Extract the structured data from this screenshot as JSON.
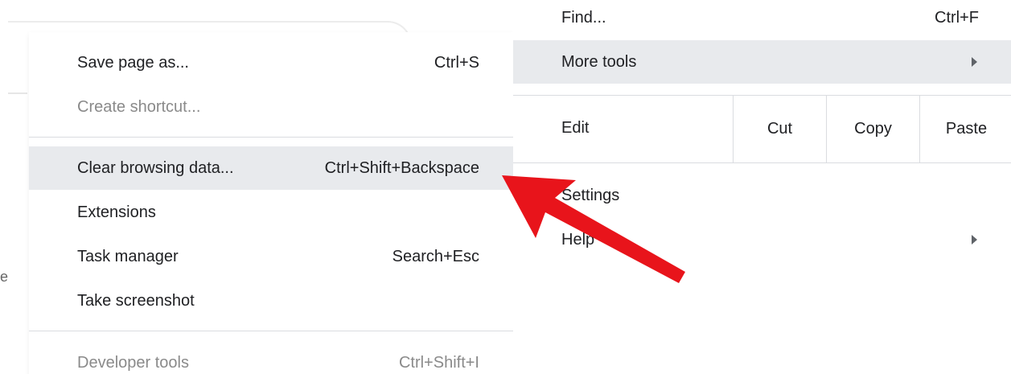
{
  "submenu": {
    "items": [
      {
        "label": "Save page as...",
        "shortcut": "Ctrl+S"
      },
      {
        "label": "Create shortcut...",
        "shortcut": ""
      },
      {
        "label": "Clear browsing data...",
        "shortcut": "Ctrl+Shift+Backspace"
      },
      {
        "label": "Extensions",
        "shortcut": ""
      },
      {
        "label": "Task manager",
        "shortcut": "Search+Esc"
      },
      {
        "label": "Take screenshot",
        "shortcut": ""
      },
      {
        "label": "Developer tools",
        "shortcut": "Ctrl+Shift+I"
      }
    ]
  },
  "mainmenu": {
    "find": {
      "label": "Find...",
      "shortcut": "Ctrl+F"
    },
    "more_tools": {
      "label": "More tools"
    },
    "edit": {
      "label": "Edit",
      "cut": "Cut",
      "copy": "Copy",
      "paste": "Paste"
    },
    "settings": {
      "label": "Settings"
    },
    "help": {
      "label": "Help"
    }
  },
  "background": {
    "left_char": "e"
  },
  "colors": {
    "highlight": "#e8eaed",
    "disabled_text": "#8a8a8a",
    "annotation_arrow": "#e8141b"
  },
  "icons": {
    "submenu_arrow": "chevron-right-icon",
    "annotation": "red-pointer-arrow"
  }
}
